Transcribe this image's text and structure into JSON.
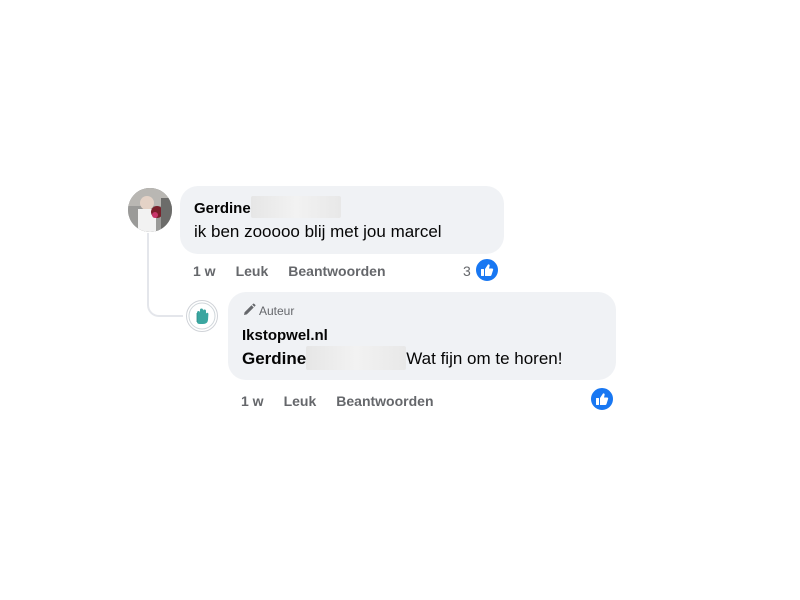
{
  "comment": {
    "author": "Gerdine",
    "text": "ik ben zooooo blij met jou marcel",
    "time": "1 w",
    "like_label": "Leuk",
    "reply_label": "Beantwoorden",
    "reaction_count": "3"
  },
  "reply": {
    "badge_label": "Auteur",
    "author": "Ikstopwel.nl",
    "mention": "Gerdine",
    "text": "Wat fijn om te horen!",
    "time": "1 w",
    "like_label": "Leuk",
    "reply_label": "Beantwoorden"
  },
  "colors": {
    "bubble": "#f0f2f5",
    "meta_text": "#65676b",
    "like_blue": "#1877f2"
  }
}
